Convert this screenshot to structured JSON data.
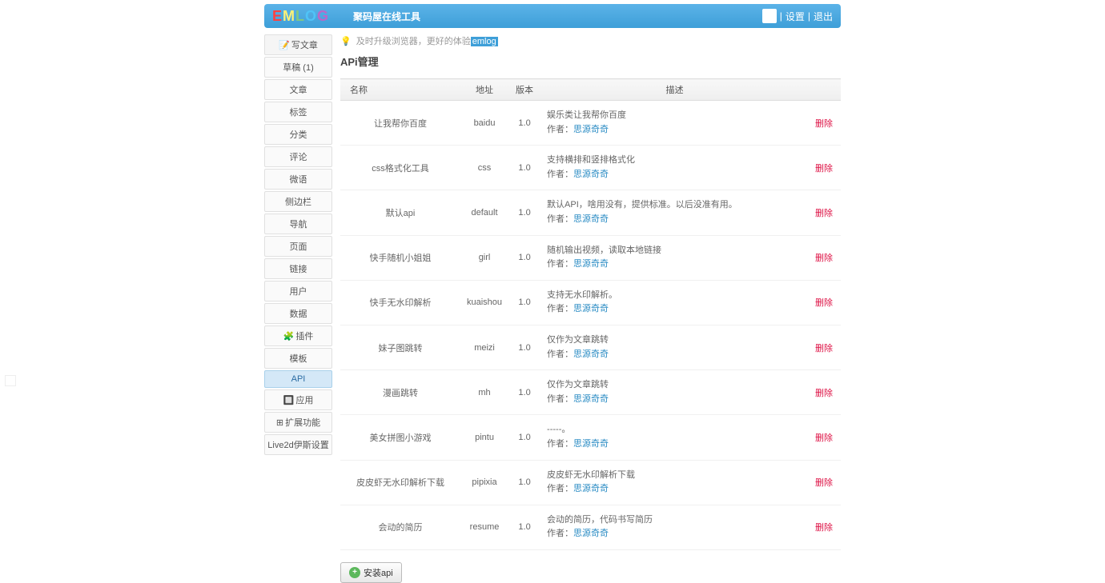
{
  "header": {
    "logo": [
      "E",
      "M",
      "L",
      "O",
      "G"
    ],
    "site_title": "聚码屋在线工具",
    "settings": "设置",
    "logout": "退出"
  },
  "tip": {
    "text": "及时升级浏览器，更好的体验",
    "link": "emlog"
  },
  "page_title": "APi管理",
  "sidebar": [
    {
      "label": "写文章",
      "icon": "📝"
    },
    {
      "label": "草稿 (1)"
    },
    {
      "label": "文章"
    },
    {
      "label": "标签"
    },
    {
      "label": "分类"
    },
    {
      "label": "评论"
    },
    {
      "label": "微语"
    },
    {
      "label": "侧边栏"
    },
    {
      "label": "导航"
    },
    {
      "label": "页面"
    },
    {
      "label": "链接"
    },
    {
      "label": "用户"
    },
    {
      "label": "数据"
    },
    {
      "label": "插件",
      "icon": "🧩"
    },
    {
      "label": "模板"
    },
    {
      "label": "API",
      "active": true
    },
    {
      "label": "应用",
      "icon": "🔲"
    },
    {
      "label": "扩展功能",
      "icon": "⊞"
    },
    {
      "label": "Live2d伊斯设置"
    }
  ],
  "table": {
    "headers": {
      "name": "名称",
      "addr": "地址",
      "ver": "版本",
      "desc": "描述",
      "op": ""
    },
    "author_prefix": "作者：",
    "author_name": "思源奇奇",
    "delete_label": "删除",
    "rows": [
      {
        "name": "让我帮你百度",
        "addr": "baidu",
        "ver": "1.0",
        "desc": "娱乐类让我帮你百度"
      },
      {
        "name": "css格式化工具",
        "addr": "css",
        "ver": "1.0",
        "desc": "支持横排和竖排格式化"
      },
      {
        "name": "默认api",
        "addr": "default",
        "ver": "1.0",
        "desc": "默认API，啥用没有，提供标准。以后没准有用。"
      },
      {
        "name": "快手随机小姐姐",
        "addr": "girl",
        "ver": "1.0",
        "desc": "随机输出视频，读取本地链接"
      },
      {
        "name": "快手无水印解析",
        "addr": "kuaishou",
        "ver": "1.0",
        "desc": "支持无水印解析。"
      },
      {
        "name": "妹子图跳转",
        "addr": "meizi",
        "ver": "1.0",
        "desc": "仅作为文章跳转"
      },
      {
        "name": "漫画跳转",
        "addr": "mh",
        "ver": "1.0",
        "desc": "仅作为文章跳转"
      },
      {
        "name": "美女拼图小游戏",
        "addr": "pintu",
        "ver": "1.0",
        "desc": "-----。"
      },
      {
        "name": "皮皮虾无水印解析下载",
        "addr": "pipixia",
        "ver": "1.0",
        "desc": "皮皮虾无水印解析下载"
      },
      {
        "name": "会动的简历",
        "addr": "resume",
        "ver": "1.0",
        "desc": "会动的简历，代码书写简历"
      }
    ]
  },
  "install_button": "安装api"
}
